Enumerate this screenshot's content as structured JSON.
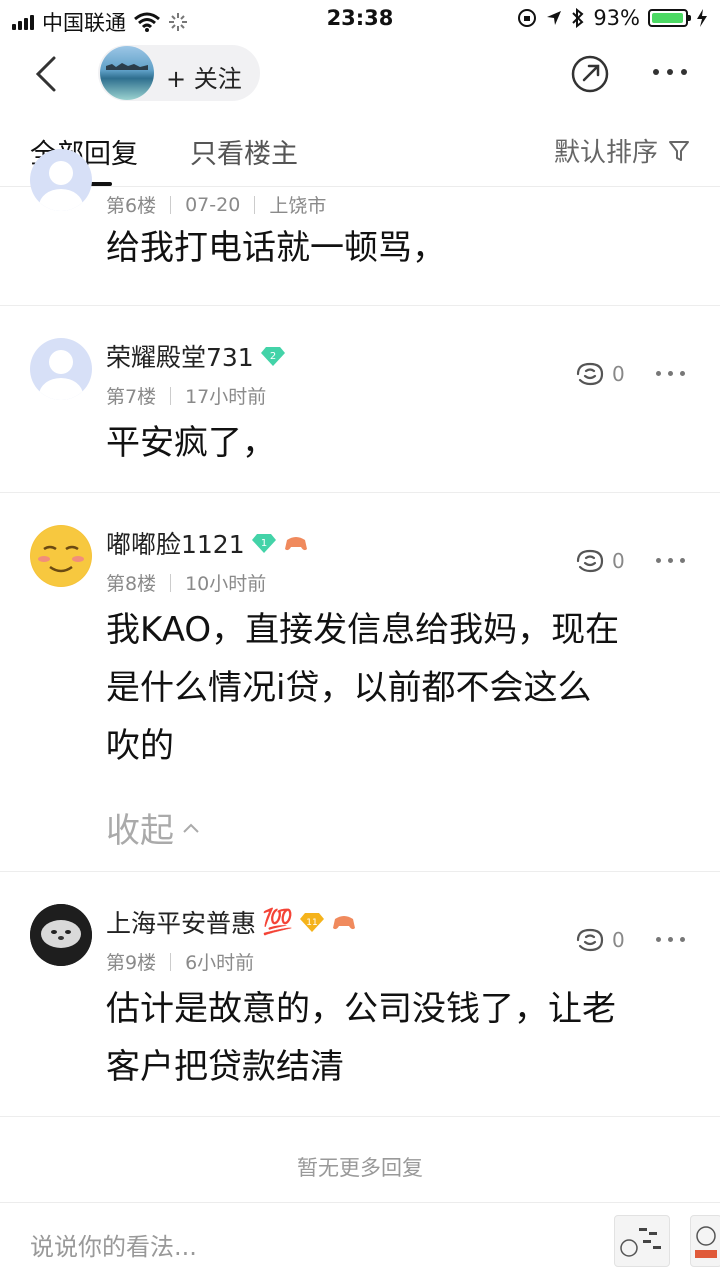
{
  "status_bar": {
    "carrier": "中国联通",
    "time": "23:38",
    "battery_percent": "93%",
    "battery_level": 0.93
  },
  "nav": {
    "follow_label": "+ 关注"
  },
  "tabs": {
    "all_replies": "全部回复",
    "only_op": "只看楼主",
    "sort_label": "默认排序"
  },
  "comments": [
    {
      "floor": "第6楼",
      "date": "07-20",
      "location": "上饶市",
      "text": "给我打电话就一顿骂，"
    },
    {
      "username": "荣耀殿堂731",
      "level": "2",
      "floor": "第7楼",
      "time": "17小时前",
      "likes": "0",
      "text": "平安疯了，"
    },
    {
      "username": "嘟嘟脸1121",
      "level": "1",
      "floor": "第8楼",
      "time": "10小时前",
      "likes": "0",
      "text_line1": "我KAO，直接发信息给我妈，现在",
      "text_line2": "是什么情况i贷，以前都不会这么",
      "text_line3": "吹的",
      "collapse_label": "收起"
    },
    {
      "username": "上海平安普惠",
      "emoji": "💯",
      "level": "11",
      "floor": "第9楼",
      "time": "6小时前",
      "likes": "0",
      "text_line1": "估计是故意的，公司没钱了，让老",
      "text_line2": "客户把贷款结清"
    }
  ],
  "footer_note": "暂无更多回复",
  "composer": {
    "placeholder": "说说你的看法..."
  },
  "colors": {
    "gem": "#43d3a8",
    "gold_badge": "#f5b31b",
    "game_badge": "#f08a5d",
    "battery": "#4cd964"
  }
}
